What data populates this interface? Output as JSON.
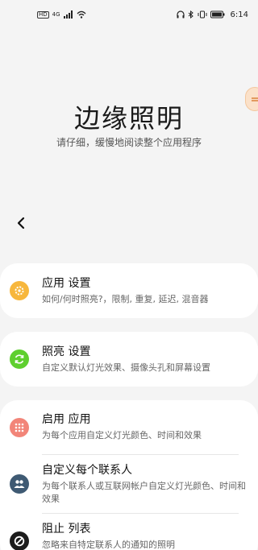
{
  "status_bar": {
    "left_badges": [
      "HD",
      "4G"
    ],
    "time": "6:14"
  },
  "hero": {
    "title": "边缘照明",
    "subtitle": "请仔细，缓慢地阅读整个应用程序"
  },
  "settings": {
    "app_settings": {
      "title": "应用 设置",
      "subtitle": "如何/何时照亮?，限制, 重复, 延迟, 混音器",
      "icon": "gear-icon",
      "color": "#f7b73d"
    },
    "lighting_settings": {
      "title": "照亮 设置",
      "subtitle": "自定义默认灯光效果、摄像头孔和屏幕设置",
      "icon": "refresh-icon",
      "color": "#5fcf2f"
    },
    "enable_apps": {
      "title": "启用 应用",
      "subtitle": "为每个应用自定义灯光颜色、时间和效果",
      "icon": "apps-grid-icon",
      "color": "#f28579"
    },
    "contacts": {
      "title": "自定义每个联系人",
      "subtitle": "为每个联系人或互联网帐户自定义灯光颜色、时间和效果",
      "icon": "contacts-icon",
      "color": "#3f5a73"
    },
    "block_list": {
      "title": "阻止 列表",
      "subtitle": "忽略来自特定联系人的通知的照明",
      "icon": "block-icon",
      "color": "#1c1c1c"
    }
  }
}
